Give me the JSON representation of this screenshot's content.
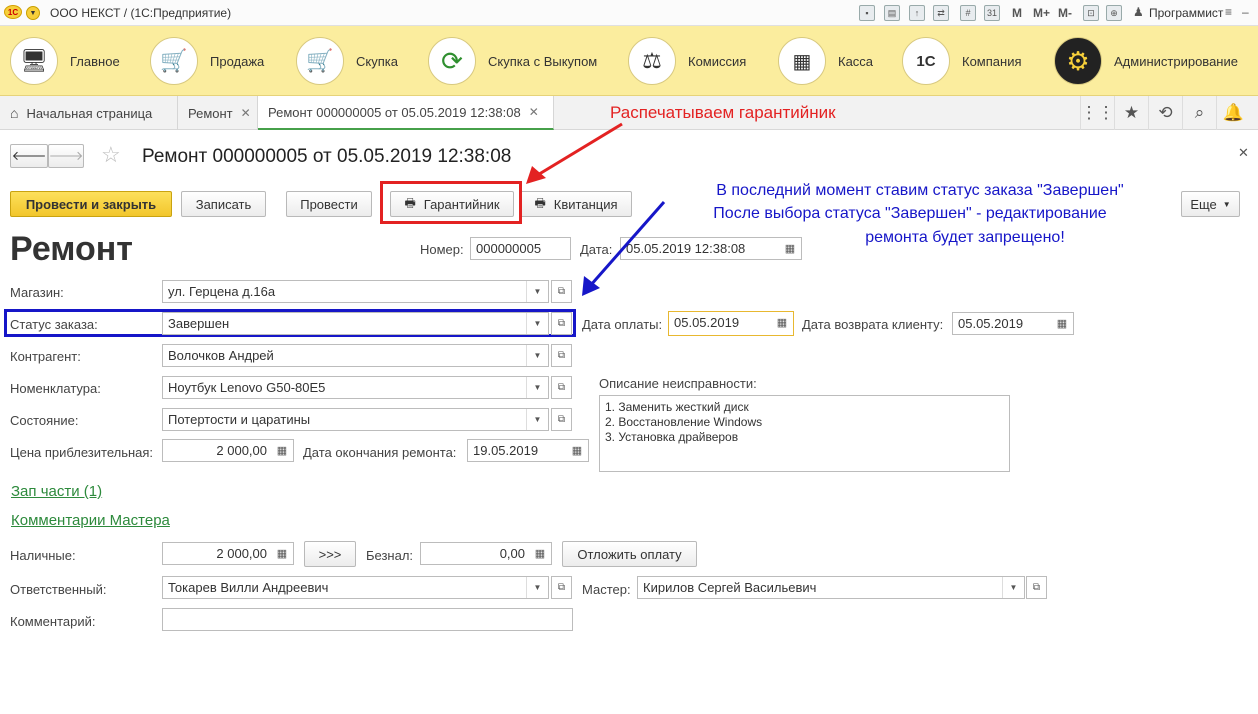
{
  "window": {
    "logo": "1С",
    "title": "ООО НЕКСТ /  (1С:Предприятие)",
    "user": "Программист",
    "toolbar_letters": [
      "M",
      "M+",
      "M-"
    ]
  },
  "sections": [
    {
      "label": "Главное",
      "icon": "computer-icon"
    },
    {
      "label": "Продажа",
      "icon": "cart-up-icon"
    },
    {
      "label": "Скупка",
      "icon": "cart-down-icon"
    },
    {
      "label": "Скупка с Выкупом",
      "icon": "cycle-arrows-icon"
    },
    {
      "label": "Комиссия",
      "icon": "scales-icon"
    },
    {
      "label": "Касса",
      "icon": "cash-register-icon"
    },
    {
      "label": "Компания",
      "icon": "1c-logo-icon"
    },
    {
      "label": "Администрирование",
      "icon": "gears-icon"
    }
  ],
  "tabs": [
    {
      "label": "Начальная страница"
    },
    {
      "label": "Ремонт"
    },
    {
      "label": "Ремонт 000000005 от 05.05.2019 12:38:08"
    }
  ],
  "form": {
    "title": "Ремонт 000000005 от 05.05.2019 12:38:08",
    "heading": "Ремонт",
    "buttons": {
      "post_close": "Провести и закрыть",
      "save": "Записать",
      "post": "Провести",
      "warranty": "Гарантийник",
      "receipt": "Квитанция",
      "more": "Еще",
      "defer": "Отложить оплату",
      "arrows": ">>>"
    },
    "number_label": "Номер:",
    "number": "000000005",
    "date_label": "Дата:",
    "date": "05.05.2019 12:38:08",
    "store_label": "Магазин:",
    "store": "ул. Герцена д.16а",
    "status_label": "Статус заказа:",
    "status": "Завершен",
    "payment_date_label": "Дата оплаты:",
    "payment_date": "05.05.2019",
    "return_date_label": "Дата возврата клиенту:",
    "return_date": "05.05.2019",
    "counterparty_label": "Контрагент:",
    "counterparty": "Волочков Андрей",
    "item_label": "Номенклатура:",
    "item": "Ноутбук Lenovo G50-80E5",
    "condition_label": "Состояние:",
    "condition": "Потертости и царатины",
    "price_label": "Цена приблезительная:",
    "price": "2 000,00",
    "end_date_label": "Дата окончания ремонта:",
    "end_date": "19.05.2019",
    "defect_label": "Описание неисправности:",
    "defect_lines": [
      "1. Заменить жесткий диск",
      "2. Восстановление Windows",
      "3. Установка драйверов"
    ],
    "parts_link": "Зап части (1)",
    "comments_link": "Комментарии Мастера",
    "cash_label": "Наличные:",
    "cash": "2 000,00",
    "noncash_label": "Безнал:",
    "noncash": "0,00",
    "responsible_label": "Ответственный:",
    "responsible": "Токарев Вилли Андреевич",
    "master_label": "Мастер:",
    "master": "Кирилов Сергей Васильевич",
    "comment_label": "Комментарий:",
    "comment": ""
  },
  "annotations": {
    "red": "Распечатываем гарантийник",
    "blue_lines": [
      "В последний момент ставим статус заказа \"Завершен\"",
      "После выбора статуса \"Завершен\" - редактирование",
      "ремонта будет запрещено!"
    ]
  },
  "colors": {
    "accent_green": "#46a04a",
    "sections_bg": "#fbed9e",
    "primary_button": "#f2c62c",
    "annotation_red": "#e32222",
    "annotation_blue": "#1616c8"
  }
}
